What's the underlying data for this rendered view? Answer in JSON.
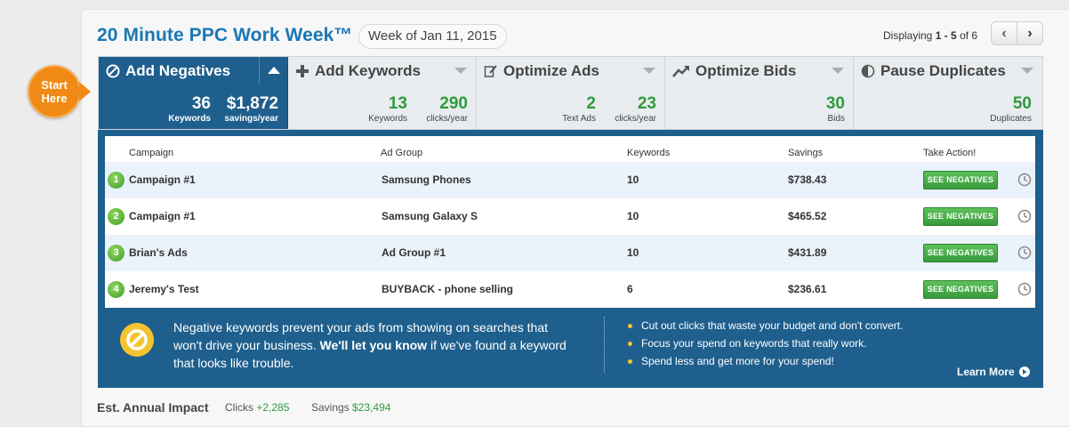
{
  "header": {
    "title": "20 Minute PPC Work Week™",
    "week": "Week of Jan 11, 2015",
    "displaying_prefix": "Displaying",
    "displaying_range": "1 - 5",
    "displaying_suffix": "of 6",
    "prev_icon": "chevron-left-icon",
    "next_icon": "chevron-right-icon"
  },
  "start_badge": {
    "line1": "Start",
    "line2": "Here"
  },
  "tabs": [
    {
      "label": "Add Negatives",
      "icon": "no-entry-icon",
      "active": true,
      "stats": [
        {
          "value": "36",
          "label": "Keywords"
        },
        {
          "value": "$1,872",
          "label": "savings/year"
        }
      ]
    },
    {
      "label": "Add Keywords",
      "icon": "plus-icon",
      "stats": [
        {
          "value": "13",
          "label": "Keywords"
        },
        {
          "value": "290",
          "label": "clicks/year"
        }
      ]
    },
    {
      "label": "Optimize Ads",
      "icon": "edit-icon",
      "stats": [
        {
          "value": "2",
          "label": "Text Ads"
        },
        {
          "value": "23",
          "label": "clicks/year"
        }
      ]
    },
    {
      "label": "Optimize Bids",
      "icon": "trend-up-icon",
      "stats": [
        {
          "value": "30",
          "label": "Bids"
        }
      ]
    },
    {
      "label": "Pause Duplicates",
      "icon": "half-circle-icon",
      "stats": [
        {
          "value": "50",
          "label": "Duplicates"
        }
      ]
    }
  ],
  "table": {
    "columns": [
      "Campaign",
      "Ad Group",
      "Keywords",
      "Savings",
      "Take Action!"
    ],
    "action_label": "SEE NEGATIVES",
    "rows": [
      {
        "rank": "1",
        "campaign": "Campaign #1",
        "ad_group": "Samsung Phones",
        "keywords": "10",
        "savings": "$738.43"
      },
      {
        "rank": "2",
        "campaign": "Campaign #1",
        "ad_group": "Samsung Galaxy S",
        "keywords": "10",
        "savings": "$465.52"
      },
      {
        "rank": "3",
        "campaign": "Brian's Ads",
        "ad_group": "Ad Group #1",
        "keywords": "10",
        "savings": "$431.89"
      },
      {
        "rank": "4",
        "campaign": "Jeremy's Test",
        "ad_group": "BUYBACK - phone selling",
        "keywords": "6",
        "savings": "$236.61"
      }
    ]
  },
  "info": {
    "text_1": "Negative keywords prevent your ads from showing on searches that won't drive your business.",
    "text_bold": "We'll let you know",
    "text_2": "if we've found a keyword that looks like trouble.",
    "bullets": [
      "Cut out clicks that waste your budget and don't convert.",
      "Focus your spend on keywords that really work.",
      "Spend less and get more for your spend!"
    ],
    "learn_more": "Learn More"
  },
  "impact": {
    "label": "Est. Annual Impact",
    "clicks_label": "Clicks",
    "clicks_value": "+2,285",
    "savings_label": "Savings",
    "savings_value": "$23,494"
  },
  "colors": {
    "title_blue": "#1a78b4",
    "panel_blue": "#1f5f8d",
    "stat_green": "#2e9b3e",
    "badge_orange": "#f08a14",
    "info_yellow": "#f4c430"
  }
}
